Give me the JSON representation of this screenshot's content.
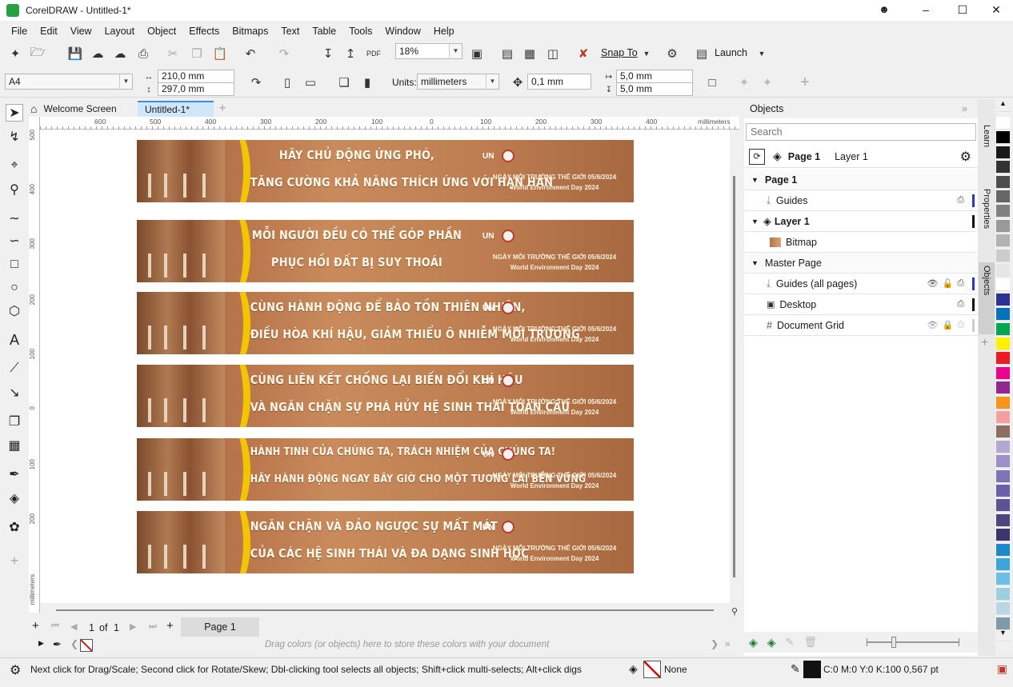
{
  "window": {
    "title": "CorelDRAW - Untitled-1*"
  },
  "menu": [
    "File",
    "Edit",
    "View",
    "Layout",
    "Object",
    "Effects",
    "Bitmaps",
    "Text",
    "Table",
    "Tools",
    "Window",
    "Help"
  ],
  "standard_toolbar": {
    "zoom": "18%",
    "snap_to": "Snap To",
    "launch": "Launch"
  },
  "property_bar": {
    "page_size": "A4",
    "width": "210,0 mm",
    "height": "297,0 mm",
    "units_label": "Units:",
    "units": "millimeters",
    "nudge": "0,1 mm",
    "dup_x": "5,0 mm",
    "dup_y": "5,0 mm"
  },
  "doc_tabs": {
    "welcome": "Welcome Screen",
    "document": "Untitled-1*"
  },
  "ruler": {
    "h_ticks": [
      "600",
      "500",
      "400",
      "300",
      "200",
      "100",
      "0",
      "100",
      "200",
      "300",
      "400"
    ],
    "h_unit": "millimeters",
    "v_ticks": [
      "500",
      "400",
      "300",
      "200",
      "100",
      "0",
      "100",
      "200"
    ],
    "v_unit": "millimeters"
  },
  "banners": [
    {
      "line1": "HÃY CHỦ ĐỘNG ỨNG PHÓ,",
      "line2": "TĂNG CƯỜNG KHẢ NĂNG THÍCH ỨNG VỚI HẠN HÁN"
    },
    {
      "line1": "MỖI NGƯỜI ĐỀU CÓ THỂ GÓP PHẦN",
      "line2": "PHỤC HỒI ĐẤT BỊ SUY THOÁI"
    },
    {
      "line1": "CÙNG HÀNH ĐỘNG ĐỂ BẢO TỒN THIÊN NHIÊN,",
      "line2": "ĐIỀU HÒA KHÍ HẬU, GIẢM THIỂU Ô NHIỄM MÔI TRƯỜNG"
    },
    {
      "line1": "CÙNG LIÊN KẾT CHỐNG LẠI BIẾN ĐỔI KHÍ HẬU",
      "line2": "VÀ NGĂN CHẶN SỰ PHÁ HỦY HỆ SINH THÁI TOÀN CẦU"
    },
    {
      "line1": "HÀNH TINH CỦA CHÚNG TA, TRÁCH NHIỆM CỦA CHÚNG TA!",
      "line2": "HÃY HÀNH ĐỘNG NGAY BÂY GIỜ CHO MỘT TƯƠNG LAI BỀN VỮNG"
    },
    {
      "line1": "NGĂN CHẶN VÀ ĐẢO NGƯỢC SỰ MẤT MÁT",
      "line2": "CỦA CÁC HỆ SINH THÁI VÀ ĐA DẠNG SINH HỌC"
    }
  ],
  "banner_common": {
    "date_vi": "NGÀY MÔI TRƯỜNG THẾ GIỚI 05/6/2024",
    "date_en": "World Environment Day 2024",
    "un": "UN"
  },
  "page_nav": {
    "current": "1",
    "of": "of",
    "total": "1",
    "page_tab": "Page 1"
  },
  "color_bar_hint": "Drag colors (or objects) here to store these colors with your document",
  "objects_docker": {
    "title": "Objects",
    "search_placeholder": "Search",
    "current_page": "Page 1",
    "current_layer": "Layer 1",
    "tree": {
      "page1": "Page 1",
      "guides": "Guides",
      "layer1": "Layer 1",
      "bitmap": "Bitmap",
      "master_page": "Master Page",
      "guides_all": "Guides (all pages)",
      "desktop": "Desktop",
      "document_grid": "Document Grid"
    }
  },
  "side_tabs": [
    "Learn",
    "Properties",
    "Objects"
  ],
  "palette_colors": [
    "#ffffff",
    "#000000",
    "#1a1a1a",
    "#333333",
    "#4d4d4d",
    "#666666",
    "#808080",
    "#999999",
    "#b3b3b3",
    "#cccccc",
    "#e6e6e6",
    "#ffffff",
    "#2e3192",
    "#0072bc",
    "#00a651",
    "#fff200",
    "#ed1c24",
    "#ec008c",
    "#92278f",
    "#f7941d",
    "#f5a0a0",
    "#8c6e62",
    "#b3a8d1",
    "#9d8fc9",
    "#7f73b8",
    "#6a5fa8",
    "#5c5393",
    "#4f4680",
    "#3b356b",
    "#1e88c8",
    "#3aa6dc",
    "#6cc0e5",
    "#9ccfe0",
    "#b8d7e3",
    "#7f9aa8"
  ],
  "status": {
    "hint": "Next click for Drag/Scale; Second click for Rotate/Skew; Dbl-clicking tool selects all objects; Shift+click multi-selects; Alt+click digs",
    "fill": "None",
    "outline": "C:0 M:0 Y:0 K:100  0,567 pt"
  }
}
